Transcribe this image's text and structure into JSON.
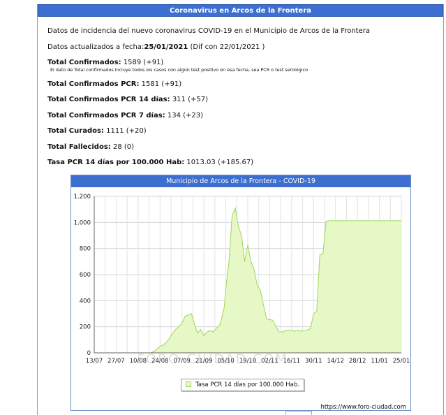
{
  "header": {
    "title": "Coronavirus en Arcos de la Frontera"
  },
  "intro": "Datos de incidencia del nuevo coronavirus COVID-19 en el Municipio de Arcos de la Frontera",
  "update": {
    "prefix": "Datos actualizados a fecha:",
    "date": "25/01/2021",
    "diff": " (Dif con 22/01/2021 )"
  },
  "stats": {
    "confirmados": {
      "label": "Total Confirmados:",
      "value": " 1589 (+91)"
    },
    "note": "El dato de Total confirmados incluye todos los casos con algún test positivo en esa fecha, sea PCR o test serológico",
    "pcr": {
      "label": "Total Confirmados PCR:",
      "value": " 1581 (+91)"
    },
    "pcr14": {
      "label": "Total Confirmados PCR 14 días:",
      "value": " 311 (+57)"
    },
    "pcr7": {
      "label": "Total Confirmados PCR 7 días:",
      "value": " 134 (+23)"
    },
    "curados": {
      "label": "Total Curados:",
      "value": " 1111 (+20)"
    },
    "fallecidos": {
      "label": "Total Fallecidos:",
      "value": " 28 (0)"
    },
    "tasa": {
      "label": "Tasa PCR 14 días por 100.000 Hab:",
      "value": " 1013.03 (+185.67)"
    }
  },
  "chart": {
    "title": "Municipio de Arcos de la Frontera - COVID-19",
    "legend": "Tasa PCR 14 días por 100.000 Hab.",
    "source": "https://www.foro-ciudad.com",
    "watermark": "FORO-CIUDAD.COM"
  },
  "colors": {
    "header": "#3d6fd0",
    "fill": "#e6f8c6",
    "line": "#9ed65a"
  },
  "chart_data": {
    "type": "area",
    "x_ticks": [
      "13/07",
      "27/07",
      "10/08",
      "24/08",
      "07/09",
      "21/09",
      "05/10",
      "19/10",
      "02/11",
      "16/11",
      "30/11",
      "14/12",
      "28/12",
      "11/01",
      "25/01"
    ],
    "y_ticks": [
      "0",
      "200",
      "400",
      "600",
      "800",
      "1.000",
      "1.200"
    ],
    "ylim": [
      0,
      1200
    ],
    "series": [
      {
        "name": "Tasa PCR 14 días por 100.000 Hab.",
        "x": [
          0,
          3,
          6,
          9,
          12,
          15,
          18,
          21,
          24,
          27,
          30,
          33,
          36,
          38,
          40,
          42,
          44,
          45,
          46,
          47,
          48,
          49,
          50,
          52,
          54,
          56,
          58,
          60,
          62,
          64,
          66,
          68,
          70,
          72,
          74,
          76,
          77,
          78,
          79,
          80,
          81,
          82,
          83,
          84,
          86,
          88,
          90,
          92,
          94,
          96,
          98,
          100,
          102,
          104,
          106,
          108,
          110,
          112,
          114,
          116,
          118,
          120,
          122,
          124,
          126,
          128,
          130,
          132,
          134,
          136,
          138,
          140,
          142,
          144,
          146,
          148,
          150,
          152,
          154,
          156,
          158,
          160,
          162,
          164,
          166,
          168,
          170,
          172,
          174,
          176,
          178,
          180,
          182,
          184,
          186,
          188,
          190,
          192,
          194,
          196
        ],
        "y": [
          0,
          0,
          0,
          0,
          0,
          0,
          0,
          0,
          0,
          0,
          0,
          0,
          0,
          10,
          30,
          50,
          60,
          70,
          80,
          95,
          110,
          130,
          150,
          180,
          200,
          230,
          280,
          290,
          300,
          220,
          150,
          180,
          130,
          160,
          170,
          160,
          175,
          190,
          200,
          210,
          250,
          300,
          350,
          500,
          700,
          1050,
          1110,
          970,
          900,
          700,
          830,
          700,
          640,
          520,
          480,
          370,
          260,
          255,
          250,
          200,
          160,
          160,
          170,
          175,
          170,
          165,
          175,
          165,
          170,
          175,
          185,
          300,
          320,
          750,
          760,
          1010,
          1013,
          1013,
          1013,
          1013,
          1013,
          1013,
          1013,
          1013,
          1013,
          1013,
          1013,
          1013,
          1013,
          1013,
          1013,
          1013,
          1013,
          1013,
          1013,
          1013,
          1013,
          1013,
          1013,
          1013
        ]
      }
    ]
  }
}
